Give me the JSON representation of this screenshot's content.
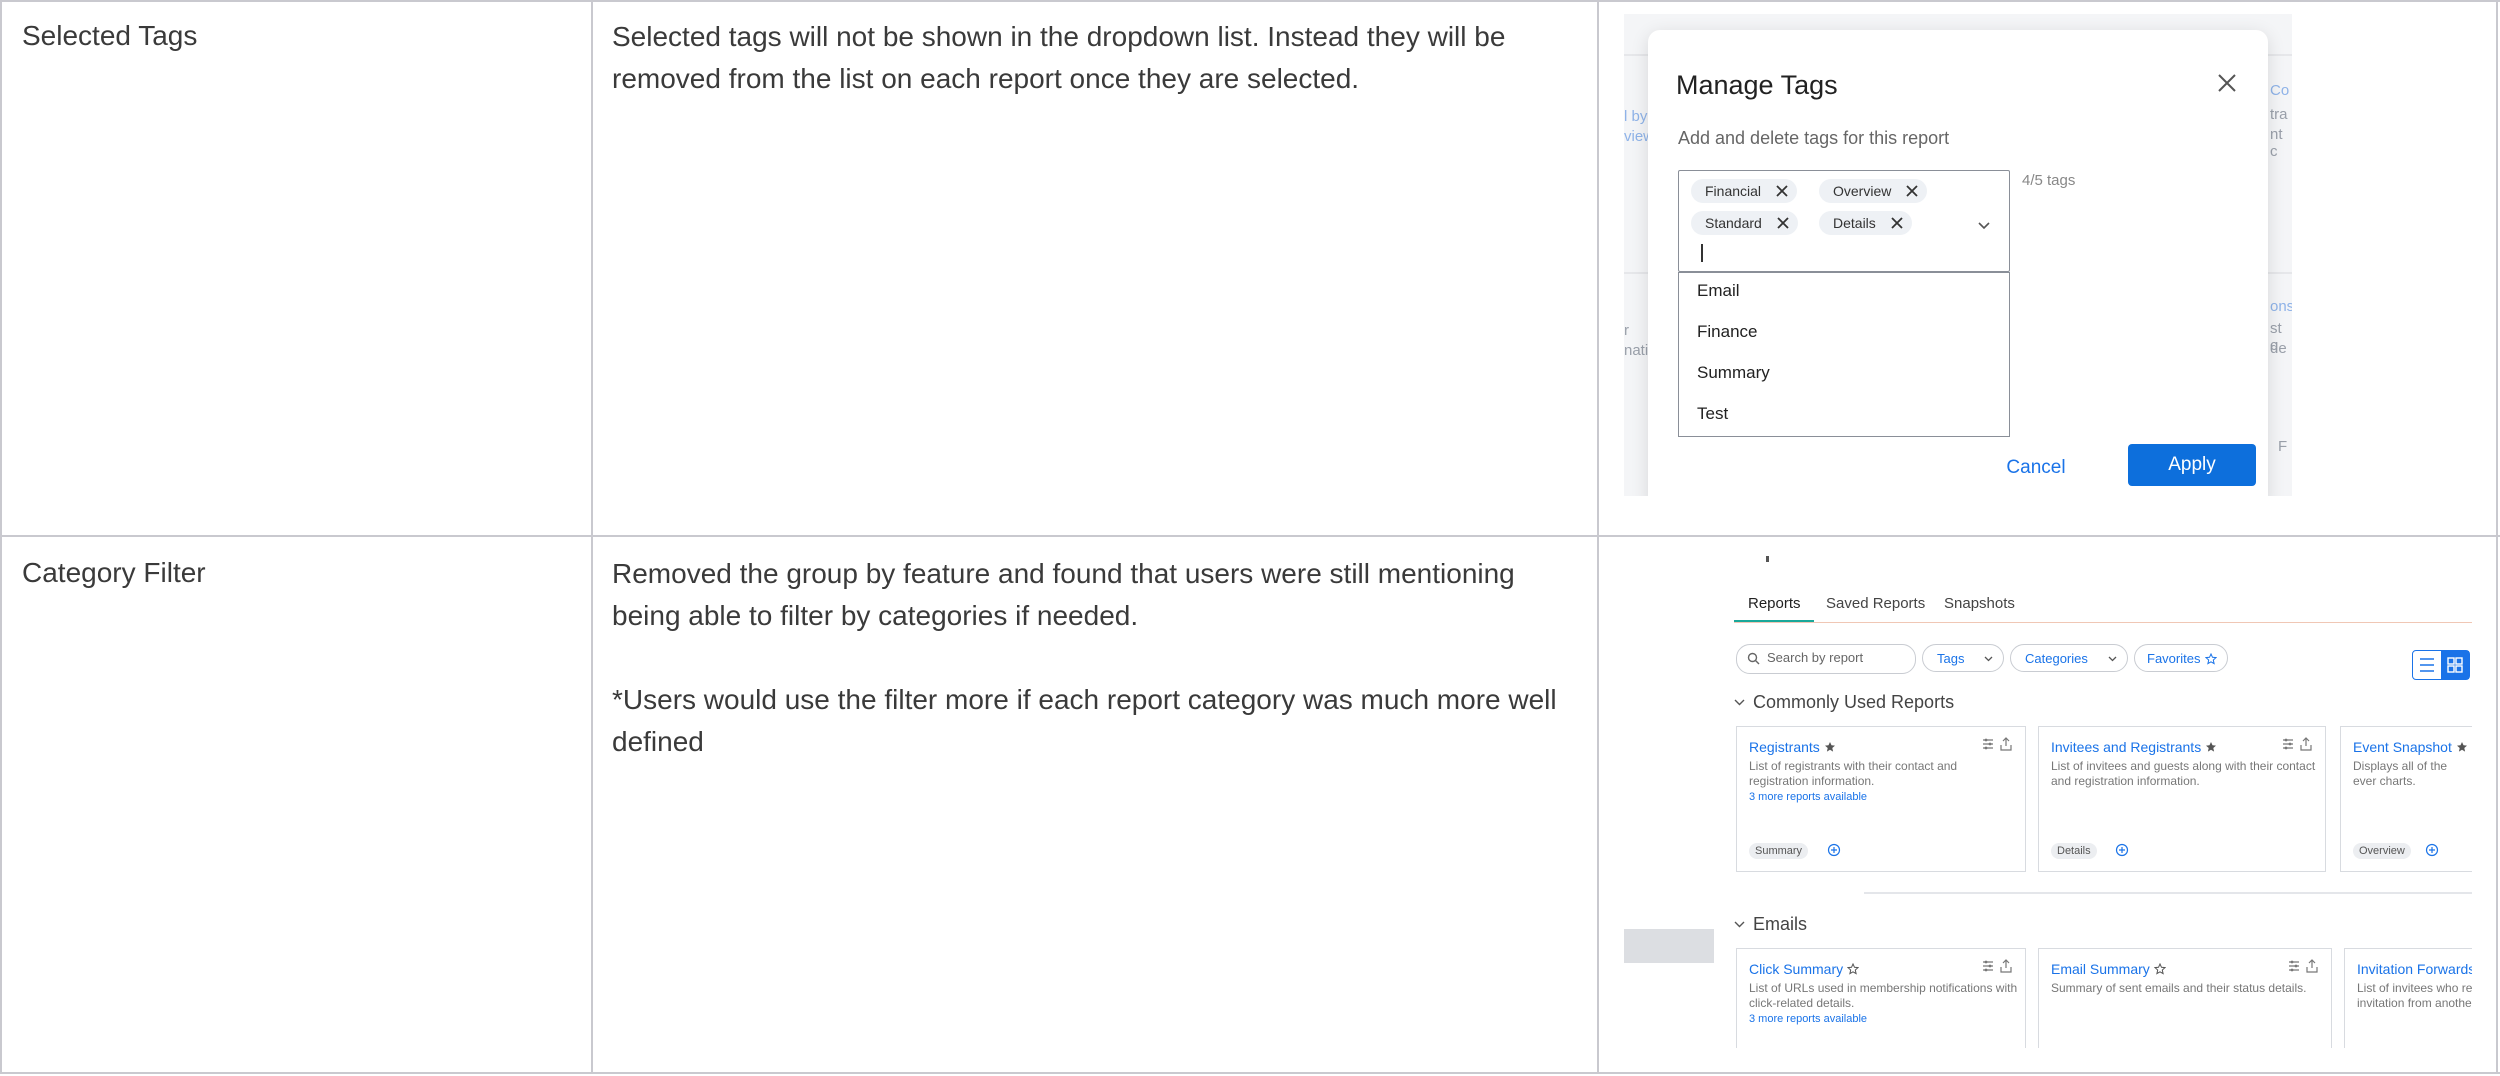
{
  "rows": [
    {
      "label": "Selected Tags",
      "description": [
        "Selected tags will not be shown in the dropdown list. Instead they will be removed from the list on each report once they are selected."
      ]
    },
    {
      "label": "Category Filter",
      "description": [
        "Removed the group by feature and found that users were still mentioning being able to filter by categories if needed.",
        "*Users would use the filter more if each report category was much more well defined"
      ]
    }
  ],
  "manage_tags_modal": {
    "title": "Manage Tags",
    "subtitle": "Add and delete tags for this report",
    "tag_count": "4/5 tags",
    "selected_tags": [
      "Financial",
      "Overview",
      "Standard",
      "Details"
    ],
    "dropdown_options": [
      "Email",
      "Finance",
      "Summary",
      "Test"
    ],
    "cancel_label": "Cancel",
    "apply_label": "Apply",
    "background_fragments": [
      "l by",
      "view",
      "Co",
      "tra",
      "nt c",
      "r",
      "nati",
      "ons",
      "st c",
      "de",
      "F"
    ]
  },
  "reports_page": {
    "tabs": [
      "Reports",
      "Saved Reports",
      "Snapshots"
    ],
    "active_tab": "Reports",
    "search_placeholder": "Search by report",
    "filters": [
      "Tags",
      "Categories",
      "Favorites"
    ],
    "sections": [
      {
        "title": "Commonly Used Reports",
        "cards": [
          {
            "title": "Registrants",
            "favorite": true,
            "description": "List of registrants with their contact and registration information.",
            "more": "3 more reports available",
            "tag": "Summary"
          },
          {
            "title": "Invitees and Registrants",
            "favorite": true,
            "description": "List of invitees and guests along with their contact and registration information.",
            "more": "",
            "tag": "Details"
          },
          {
            "title": "Event Snapshot",
            "favorite": true,
            "description": "Displays all of the ever charts.",
            "more": "",
            "tag": "Overview"
          }
        ]
      },
      {
        "title": "Emails",
        "cards": [
          {
            "title": "Click Summary",
            "favorite": false,
            "description": "List of URLs used in membership notifications with click-related details.",
            "more": "3 more reports available",
            "tag": ""
          },
          {
            "title": "Email Summary",
            "favorite": false,
            "description": "Summary of sent emails and their status details.",
            "more": "",
            "tag": ""
          },
          {
            "title": "Invitation Forwards",
            "favorite": false,
            "description": "List of invitees who re invitation from anothe",
            "more": "",
            "tag": ""
          }
        ]
      }
    ]
  },
  "colors": {
    "grid": "#c9c9cf",
    "primary_blue": "#0d6fdc",
    "tab_underline": "#1aa89a"
  }
}
